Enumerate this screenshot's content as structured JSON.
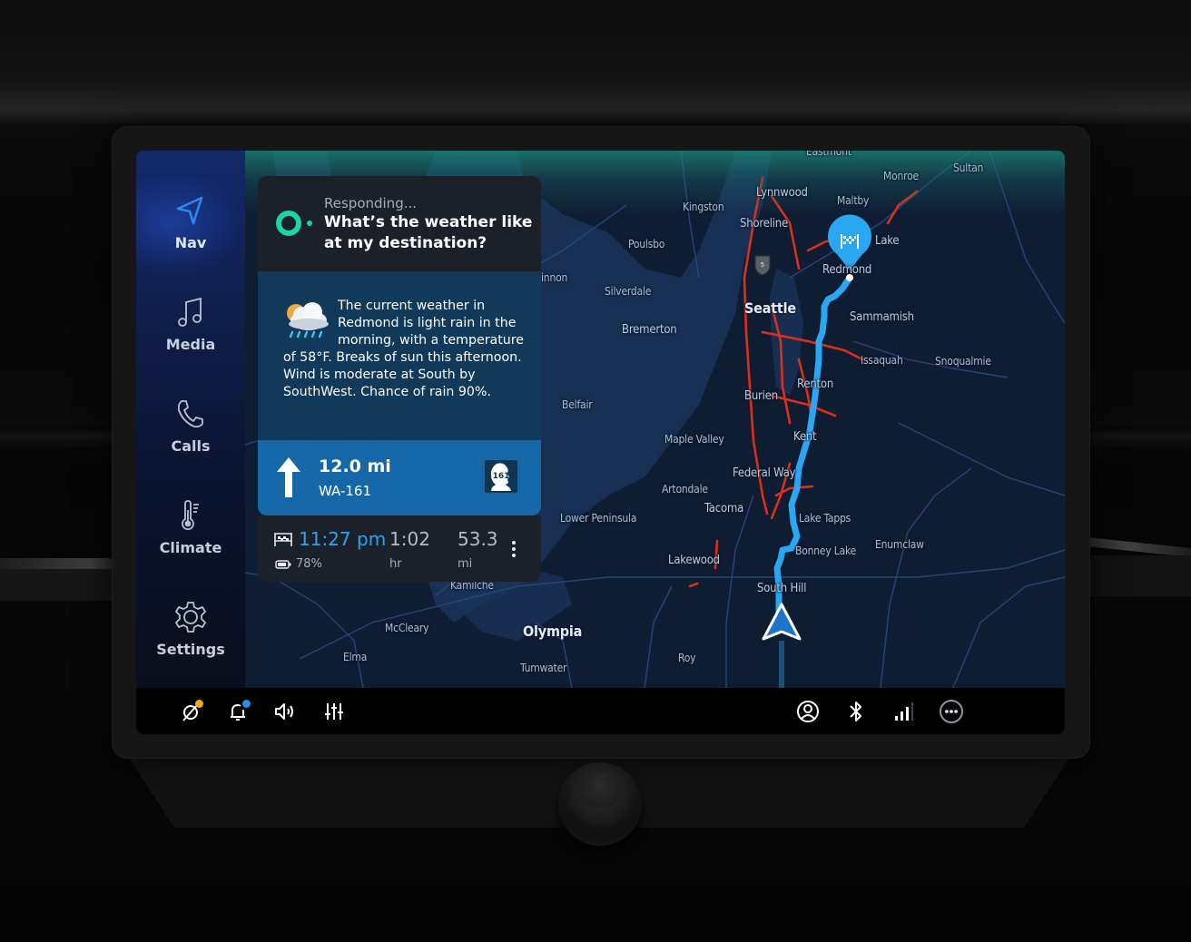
{
  "nav": {
    "items": [
      {
        "label": "Nav",
        "icon": "navigation-arrow-icon",
        "active": true
      },
      {
        "label": "Media",
        "icon": "music-note-icon",
        "active": false
      },
      {
        "label": "Calls",
        "icon": "phone-icon",
        "active": false
      },
      {
        "label": "Climate",
        "icon": "thermometer-icon",
        "active": false
      },
      {
        "label": "Settings",
        "icon": "gear-icon",
        "active": false
      }
    ]
  },
  "assistant": {
    "status": "Responding...",
    "question": "What’s the weather like at my destination?",
    "accent_color": "#1ed4a0"
  },
  "weather": {
    "icon": "cloud-rain-sun-icon",
    "text": "The current weather in Redmond is light rain in the morning, with a temperature of 58°F. Breaks of sun this afternoon. Wind is moderate at South by SouthWest. Chance of rain 90%."
  },
  "maneuver": {
    "direction": "straight",
    "distance": "12.0 mi",
    "road": "WA-161",
    "shield_number": "161"
  },
  "trip": {
    "eta": "11:27 pm",
    "duration": "1:02",
    "duration_unit": "hr",
    "distance": "53.3",
    "distance_unit": "mi",
    "battery": "78%",
    "eta_color": "#2ea4ee"
  },
  "map": {
    "destination": "Redmond",
    "route_color": "#2aa7f2",
    "traffic_color": "#e2321e",
    "highway_shield": "5",
    "labels": [
      {
        "text": "Eastmont",
        "class": ""
      },
      {
        "text": "Sultan",
        "class": ""
      },
      {
        "text": "Monroe",
        "class": ""
      },
      {
        "text": "Lynnwood",
        "class": "mid"
      },
      {
        "text": "Maltby",
        "class": ""
      },
      {
        "text": "Kingston",
        "class": ""
      },
      {
        "text": "Shoreline",
        "class": "mid"
      },
      {
        "text": "Lake",
        "class": "mid"
      },
      {
        "text": "Poulsbo",
        "class": ""
      },
      {
        "text": "Redmond",
        "class": "mid"
      },
      {
        "text": "innon",
        "class": ""
      },
      {
        "text": "Silverdale",
        "class": ""
      },
      {
        "text": "Seattle",
        "class": "big"
      },
      {
        "text": "Sammamish",
        "class": "mid"
      },
      {
        "text": "Bremerton",
        "class": "mid"
      },
      {
        "text": "Issaquah",
        "class": ""
      },
      {
        "text": "Snoqualmie",
        "class": ""
      },
      {
        "text": "Renton",
        "class": "mid"
      },
      {
        "text": "Burien",
        "class": "mid"
      },
      {
        "text": "Belfair",
        "class": ""
      },
      {
        "text": "Kent",
        "class": "mid"
      },
      {
        "text": "Maple Valley",
        "class": ""
      },
      {
        "text": "Federal Way",
        "class": "mid"
      },
      {
        "text": "Artondale",
        "class": ""
      },
      {
        "text": "Tacoma",
        "class": "mid"
      },
      {
        "text": "Lower Peninsula",
        "class": ""
      },
      {
        "text": "Lake Tapps",
        "class": ""
      },
      {
        "text": "Enumclaw",
        "class": ""
      },
      {
        "text": "Bonney Lake",
        "class": ""
      },
      {
        "text": "Lakewood",
        "class": "mid"
      },
      {
        "text": "South Hill",
        "class": "mid"
      },
      {
        "text": "Kamilche",
        "class": ""
      },
      {
        "text": "McCleary",
        "class": ""
      },
      {
        "text": "Olympia",
        "class": "big"
      },
      {
        "text": "Elma",
        "class": ""
      },
      {
        "text": "Roy",
        "class": ""
      },
      {
        "text": "Tumwater",
        "class": ""
      }
    ]
  },
  "status_bar": {
    "left": [
      {
        "icon": "voice-assistant-off-icon",
        "badge_color": "#f5a623"
      },
      {
        "icon": "bell-icon",
        "badge_color": "#2a8ef0"
      },
      {
        "icon": "volume-icon",
        "badge_color": null
      },
      {
        "icon": "equalizer-icon",
        "badge_color": null
      }
    ],
    "right": [
      {
        "icon": "user-profile-icon"
      },
      {
        "icon": "bluetooth-icon"
      },
      {
        "icon": "signal-strength-icon",
        "level": 0.75
      },
      {
        "icon": "more-options-icon"
      }
    ]
  }
}
